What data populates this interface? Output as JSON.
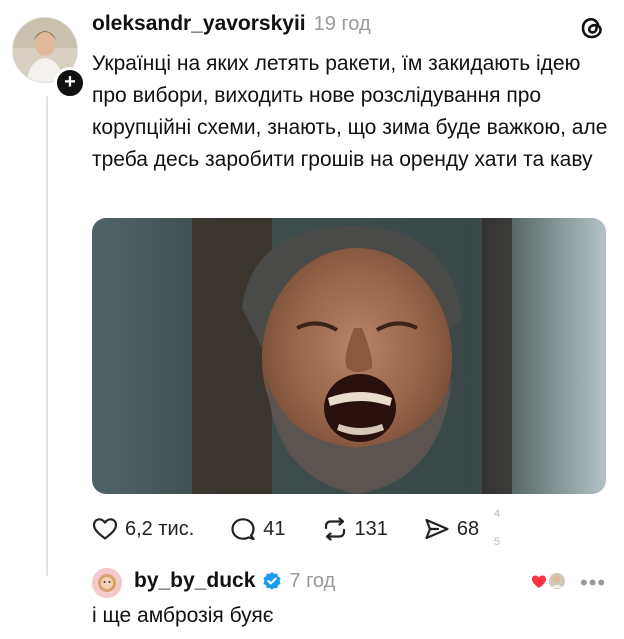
{
  "post": {
    "username": "oleksandr_yavorskyii",
    "time": "19 год",
    "text": "Українці на яких летять ракети, їм закидають ідею про вибори, виходить нове розслідування про корупційні схеми, знають, що зима буде важкою, але треба десь заробити грошів на оренду хати та каву",
    "likes": "6,2 тис.",
    "comments": "41",
    "reposts": "131",
    "shares": "68",
    "overlay_numbers": [
      "4",
      "5"
    ]
  },
  "reply": {
    "username": "by_by_duck",
    "time": "7 год",
    "text": "і ще амброзія буяє",
    "more_label": "•••"
  },
  "icons": {
    "threads": "threads-logo-icon",
    "like": "heart-icon",
    "comment": "comment-bubble-icon",
    "repost": "repost-icon",
    "share": "send-icon",
    "verified": "verified-badge-icon",
    "add": "plus-icon"
  },
  "colors": {
    "text": "#111111",
    "muted": "#9a9a9a",
    "verified_blue": "#1d9bf0",
    "heart_red": "#ff3040"
  },
  "add_label": "+"
}
